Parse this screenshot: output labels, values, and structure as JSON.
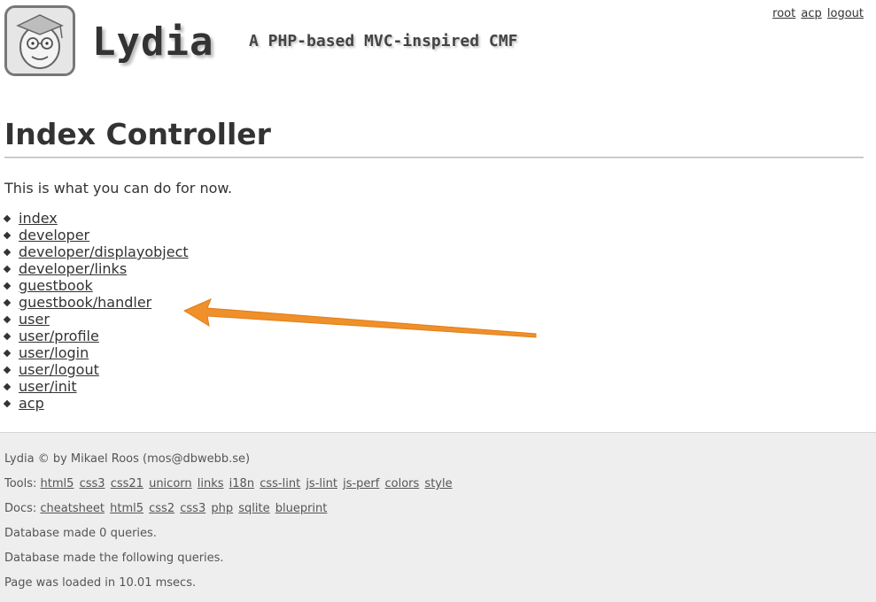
{
  "header": {
    "site_title": "Lydia",
    "slogan": "A PHP-based MVC-inspired CMF",
    "logo_icon": "professor-face-logo-icon",
    "login_menu": [
      "root",
      "acp",
      "logout"
    ]
  },
  "main": {
    "title": "Index Controller",
    "intro": "This is what you can do for now.",
    "links": [
      "index",
      "developer",
      "developer/displayobject",
      "developer/links",
      "guestbook",
      "guestbook/handler",
      "user",
      "user/profile",
      "user/login",
      "user/logout",
      "user/init",
      "acp"
    ]
  },
  "annotation": {
    "arrow_color": "#f0902a",
    "arrow_points_to": "guestbook/handler"
  },
  "footer": {
    "copyright": "Lydia © by Mikael Roos (mos@dbwebb.se)",
    "tools_label": "Tools:",
    "tools": [
      "html5",
      "css3",
      "css21",
      "unicorn",
      "links",
      "i18n",
      "css-lint",
      "js-lint",
      "js-perf",
      "colors",
      "style"
    ],
    "docs_label": "Docs:",
    "docs": [
      "cheatsheet",
      "html5",
      "css2",
      "css3",
      "php",
      "sqlite",
      "blueprint"
    ],
    "db_count": "Database made 0 queries.",
    "db_queries": "Database made the following queries.",
    "load_time": "Page was loaded in 10.01 msecs."
  }
}
